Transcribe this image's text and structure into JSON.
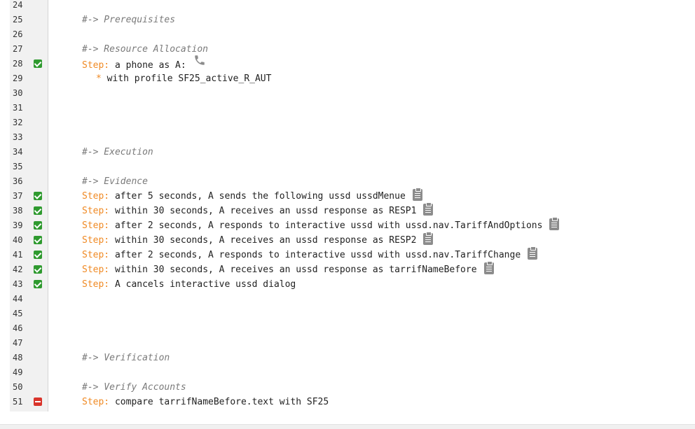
{
  "lines": [
    {
      "num": "24"
    },
    {
      "num": "25",
      "comment": "#-> Prerequisites"
    },
    {
      "num": "26"
    },
    {
      "num": "27",
      "comment": "#-> Resource Allocation"
    },
    {
      "num": "28",
      "status": "ok",
      "step_kw": "Step:",
      "step_text": " a phone as A:",
      "icon": "phone-icon"
    },
    {
      "num": "29",
      "bullet": "*",
      "bullet_text": " with profile SF25_active_R_AUT"
    },
    {
      "num": "30"
    },
    {
      "num": "31"
    },
    {
      "num": "32"
    },
    {
      "num": "33"
    },
    {
      "num": "34",
      "comment": "#-> Execution"
    },
    {
      "num": "35"
    },
    {
      "num": "36",
      "comment": "#-> Evidence"
    },
    {
      "num": "37",
      "status": "ok",
      "step_kw": "Step:",
      "step_text": " after 5 seconds, A sends the following ussd ussdMenue",
      "icon": "clipboard-icon"
    },
    {
      "num": "38",
      "status": "ok",
      "step_kw": "Step:",
      "step_text": " within 30 seconds, A receives an ussd response as RESP1",
      "icon": "clipboard-icon"
    },
    {
      "num": "39",
      "status": "ok",
      "step_kw": "Step:",
      "step_text": " after 2 seconds, A responds to interactive ussd with ussd.nav.TariffAndOptions",
      "icon": "clipboard-icon"
    },
    {
      "num": "40",
      "status": "ok",
      "step_kw": "Step:",
      "step_text": " within 30 seconds, A receives an ussd response as RESP2",
      "icon": "clipboard-icon"
    },
    {
      "num": "41",
      "status": "ok",
      "step_kw": "Step:",
      "step_text": " after 2 seconds, A responds to interactive ussd with ussd.nav.TariffChange",
      "icon": "clipboard-icon"
    },
    {
      "num": "42",
      "status": "ok",
      "step_kw": "Step:",
      "step_text": " within 30 seconds, A receives an ussd response as tarrifNameBefore",
      "icon": "clipboard-icon"
    },
    {
      "num": "43",
      "status": "ok",
      "step_kw": "Step:",
      "step_text": " A cancels interactive ussd dialog"
    },
    {
      "num": "44"
    },
    {
      "num": "45"
    },
    {
      "num": "46"
    },
    {
      "num": "47"
    },
    {
      "num": "48",
      "comment": "#-> Verification"
    },
    {
      "num": "49"
    },
    {
      "num": "50",
      "comment": "#-> Verify Accounts"
    },
    {
      "num": "51",
      "status": "fail",
      "step_kw": "Step:",
      "step_text": " compare tarrifNameBefore.text with SF25"
    }
  ],
  "colors": {
    "keyword": "#f08a24",
    "comment": "#7a7a7a",
    "status_ok": "#2f9a2f",
    "status_fail": "#d9342b",
    "icon_gray": "#8c8c8c"
  }
}
